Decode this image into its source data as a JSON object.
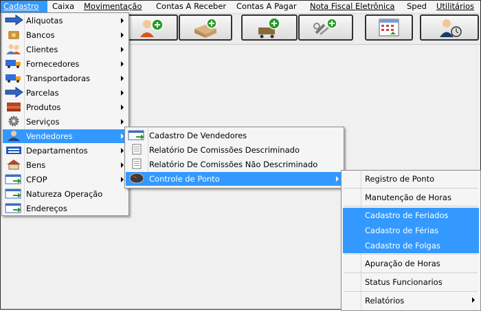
{
  "menubar": {
    "items": [
      {
        "label": "Cadastro"
      },
      {
        "label": "Caixa"
      },
      {
        "label": "Movimentação"
      },
      {
        "label": "Contas A Receber"
      },
      {
        "label": "Contas A Pagar"
      },
      {
        "label": "Nota Fiscal Eletrônica"
      },
      {
        "label": "Sped"
      },
      {
        "label": "Utilitários"
      }
    ],
    "active_color": "#3399ff"
  },
  "toolbar": {
    "buttons": [
      {
        "icon": "add-user-icon"
      },
      {
        "icon": "add-box-icon"
      },
      {
        "icon": "add-cart-icon"
      },
      {
        "icon": "tools-icon"
      },
      {
        "icon": "calendar-icon"
      },
      {
        "icon": "user-clock-icon"
      }
    ]
  },
  "cadastro_menu": {
    "items": [
      {
        "label": "Aliquotas",
        "icon": "arrow-right-icon",
        "submenu": true
      },
      {
        "label": "Bancos",
        "icon": "bank-icon",
        "submenu": true
      },
      {
        "label": "Clientes",
        "icon": "users-icon",
        "submenu": true
      },
      {
        "label": "Fornecedores",
        "icon": "truck-icon",
        "submenu": true
      },
      {
        "label": "Transportadoras",
        "icon": "truck-icon",
        "submenu": true
      },
      {
        "label": "Parcelas",
        "icon": "arrow-right-icon",
        "submenu": true
      },
      {
        "label": "Produtos",
        "icon": "boxes-icon",
        "submenu": true
      },
      {
        "label": "Serviços",
        "icon": "gear-icon",
        "submenu": true
      },
      {
        "label": "Vendedores",
        "icon": "user-icon",
        "submenu": true,
        "highlighted": true
      },
      {
        "label": "Departamentos",
        "icon": "departments-icon",
        "submenu": true
      },
      {
        "label": "Bens",
        "icon": "house-icon",
        "submenu": true
      },
      {
        "label": "CFOP",
        "icon": "window-arrow-icon",
        "submenu": true
      },
      {
        "label": "Natureza Operação",
        "icon": "window-arrow-icon",
        "submenu": false
      },
      {
        "label": "Endereços",
        "icon": "window-arrow-icon",
        "submenu": false
      }
    ]
  },
  "vendedores_menu": {
    "items": [
      {
        "label": "Cadastro De Vendedores",
        "icon": "window-arrow-icon",
        "submenu": false
      },
      {
        "label": "Relatório De Comissões Descriminado",
        "icon": "document-icon",
        "submenu": false
      },
      {
        "label": "Relatório De Comissões Não Descriminado",
        "icon": "document-icon",
        "submenu": false
      },
      {
        "label": "Controle de Ponto",
        "icon": "clock-icon",
        "submenu": true,
        "highlighted": true
      }
    ]
  },
  "ponto_menu": {
    "items": [
      {
        "label": "Registro de Ponto"
      },
      {
        "label": "Manutenção de Horas"
      },
      {
        "label": "Cadastro de Feriados",
        "highlighted": true
      },
      {
        "label": "Cadastro de Férias",
        "highlighted": true
      },
      {
        "label": "Cadastro de Folgas",
        "highlighted": true
      },
      {
        "label": "Apuração de Horas"
      },
      {
        "label": "Status Funcionarios"
      },
      {
        "label": "Relatórios",
        "submenu": true
      }
    ]
  }
}
